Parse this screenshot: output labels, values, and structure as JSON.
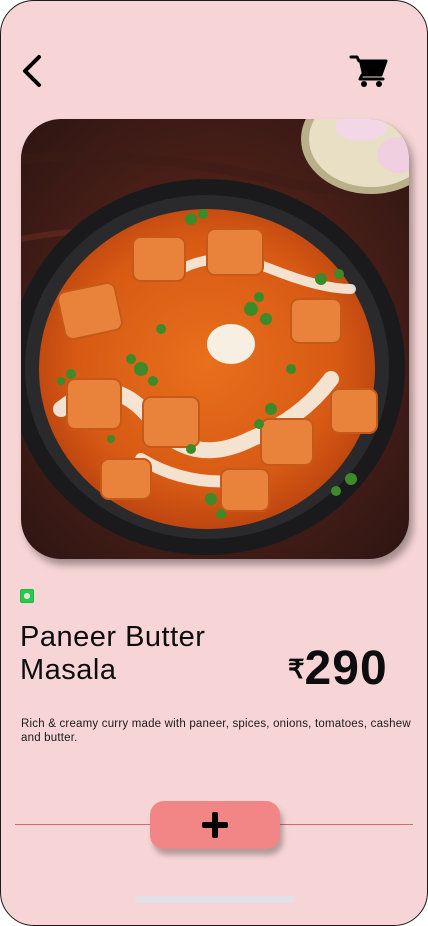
{
  "header": {
    "back_icon": "chevron-left-icon",
    "cart_icon": "cart-icon"
  },
  "dish": {
    "image_alt": "Paneer Butter Masala in a black bowl",
    "veg_indicator_icon": "veg-dot-icon",
    "name": "Paneer Butter Masala",
    "currency": "₹",
    "price": "290",
    "description": "Rich & creamy curry made with paneer, spices, onions, tomatoes, cashew and butter."
  },
  "actions": {
    "add_icon": "plus-icon"
  },
  "colors": {
    "background": "#f7d5d6",
    "accent": "#f28585",
    "veg_green": "#22cc44"
  }
}
